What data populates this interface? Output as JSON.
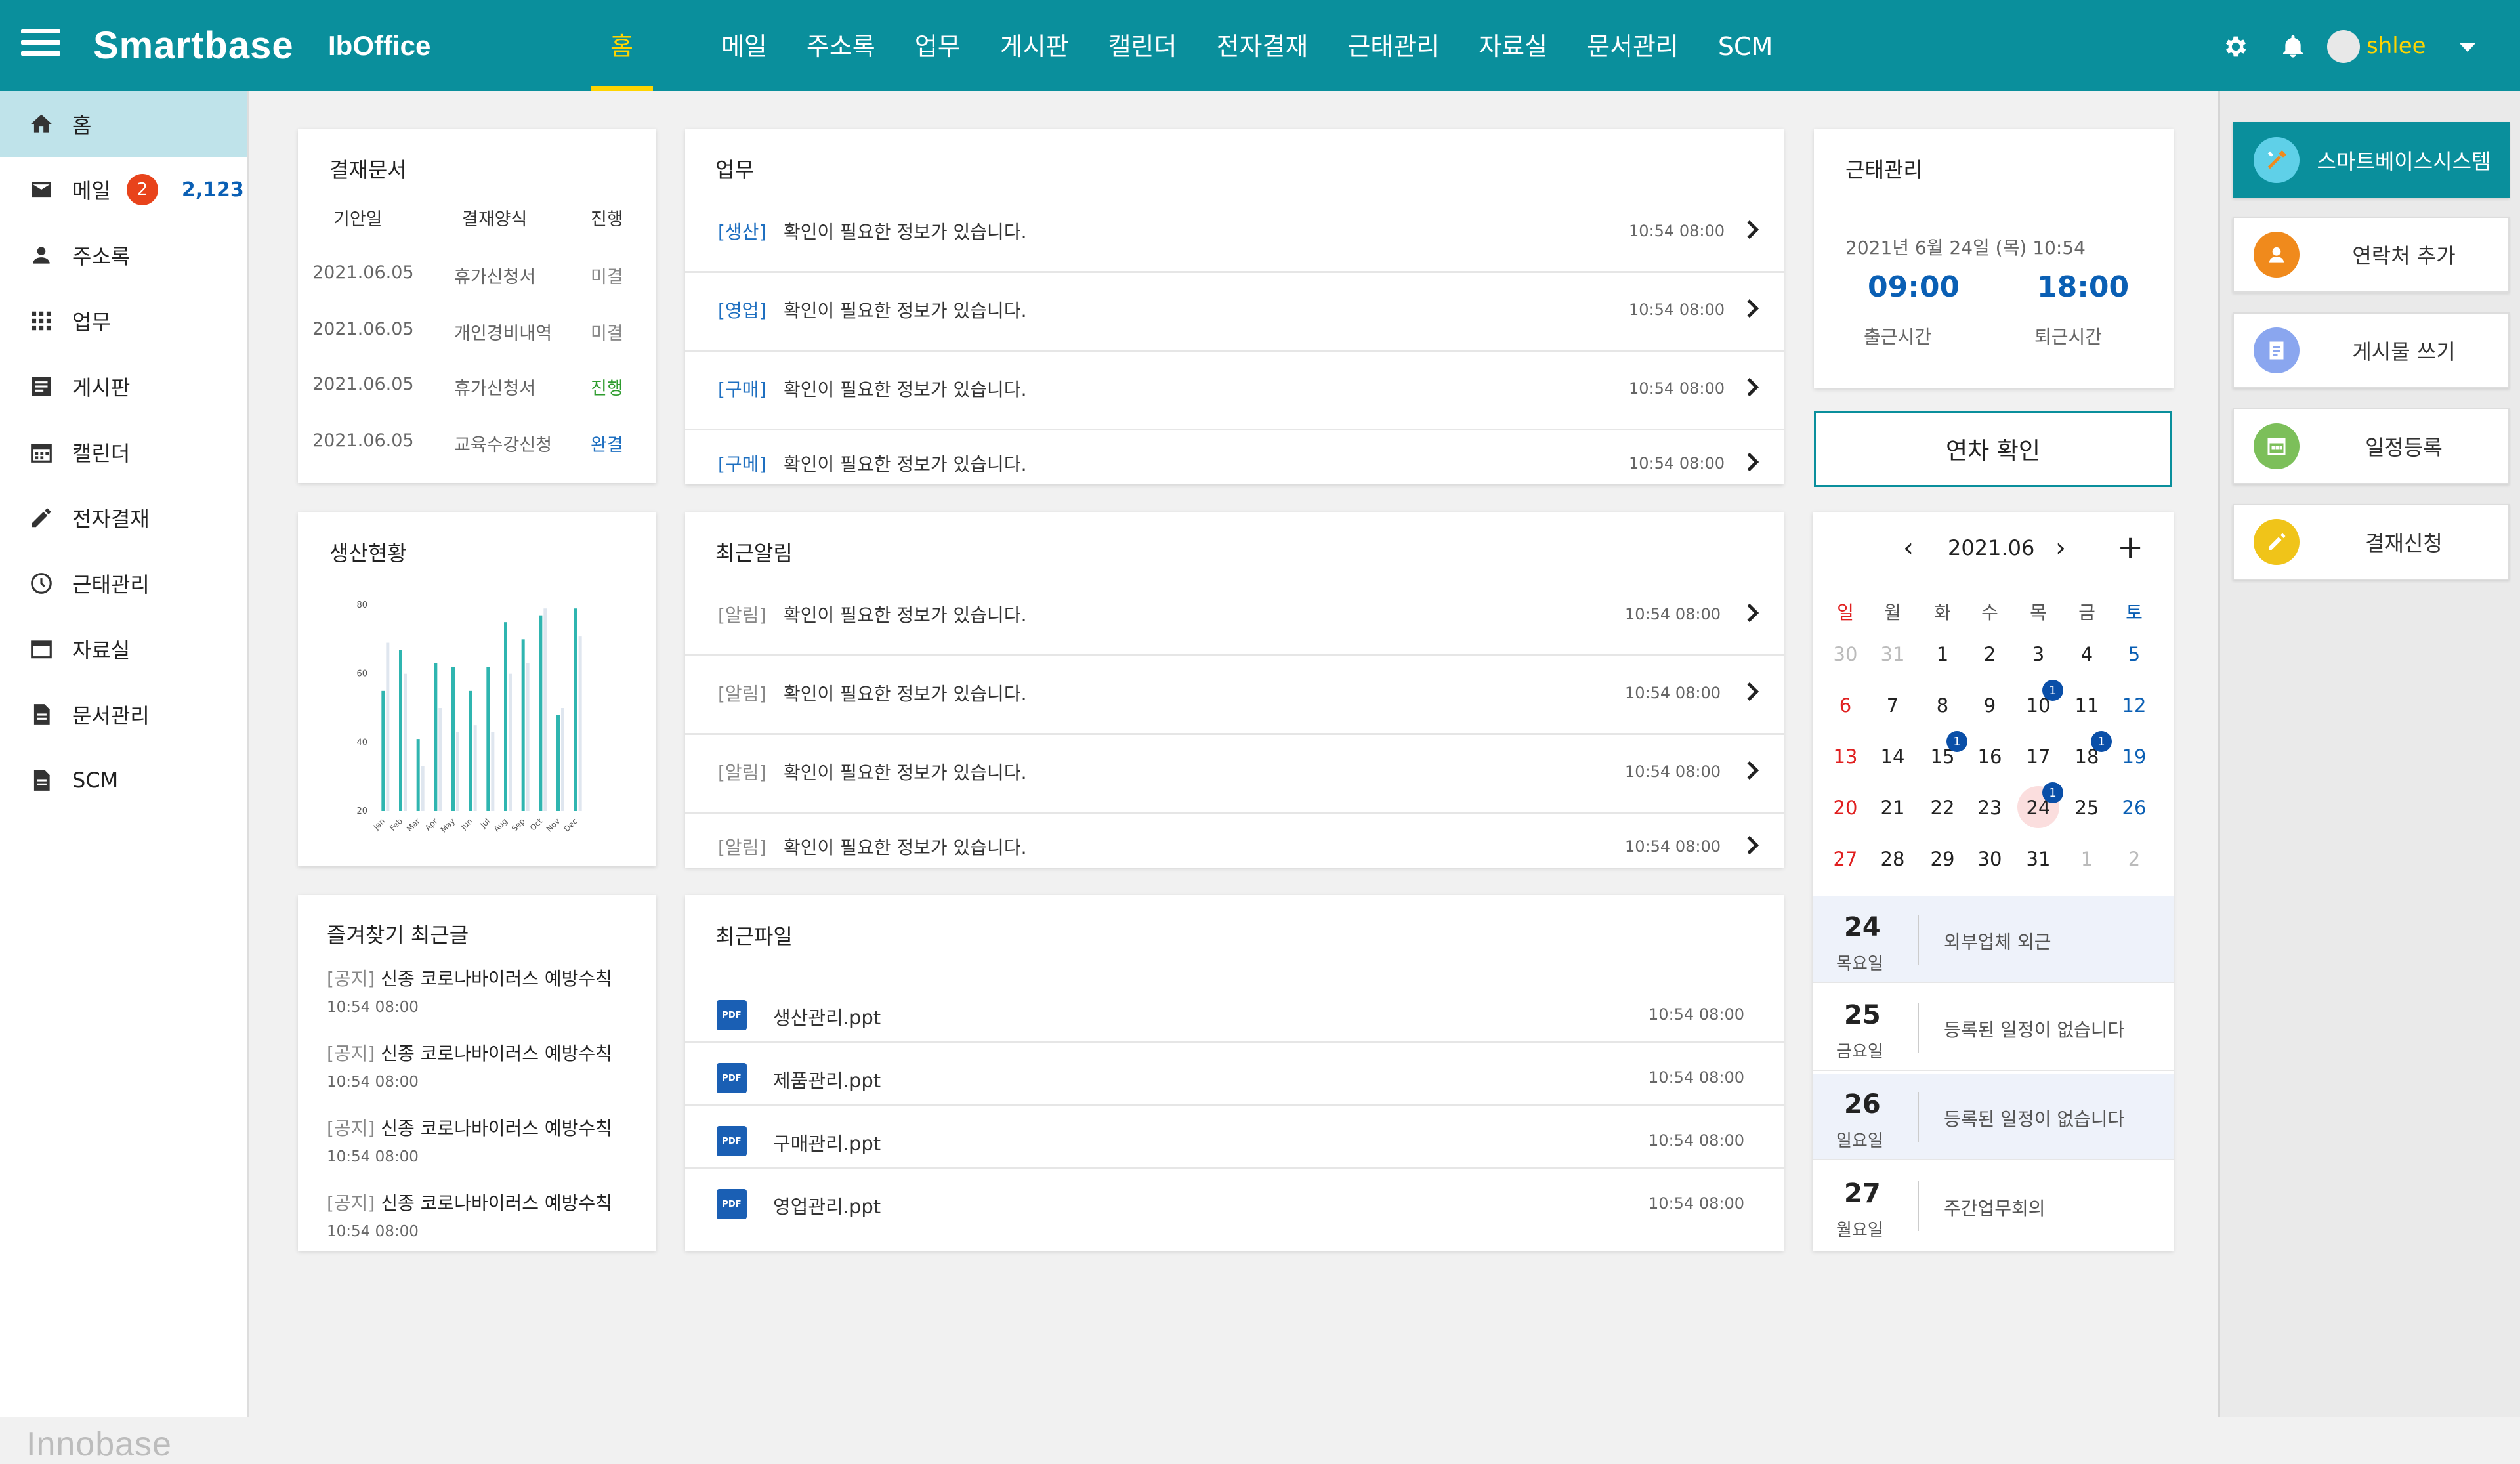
{
  "brand": {
    "name": "Smartbase",
    "product": "IbOffice",
    "footer": "Innobase"
  },
  "nav": [
    "홈",
    "메일",
    "주소록",
    "업무",
    "게시판",
    "캘린더",
    "전자결재",
    "근태관리",
    "자료실",
    "문서관리",
    "SCM"
  ],
  "user": {
    "name": "shlee"
  },
  "sidebar": {
    "items": [
      {
        "label": "홈",
        "icon": "home-icon"
      },
      {
        "label": "메일",
        "icon": "mail-icon",
        "badge": "2",
        "count": "2,123"
      },
      {
        "label": "주소록",
        "icon": "person-icon"
      },
      {
        "label": "업무",
        "icon": "grid-icon"
      },
      {
        "label": "게시판",
        "icon": "board-icon"
      },
      {
        "label": "캘린더",
        "icon": "calendar-icon"
      },
      {
        "label": "전자결재",
        "icon": "pen-icon"
      },
      {
        "label": "근태관리",
        "icon": "clock-icon"
      },
      {
        "label": "자료실",
        "icon": "folder-icon"
      },
      {
        "label": "문서관리",
        "icon": "document-icon"
      },
      {
        "label": "SCM",
        "icon": "scm-icon"
      }
    ]
  },
  "approval": {
    "title": "결재문서",
    "headers": [
      "기안일",
      "결재양식",
      "진행"
    ],
    "rows": [
      {
        "date": "2021.06.05",
        "form": "휴가신청서",
        "status": "미결",
        "status_color": "#888888"
      },
      {
        "date": "2021.06.05",
        "form": "개인경비내역",
        "status": "미결",
        "status_color": "#888888"
      },
      {
        "date": "2021.06.05",
        "form": "휴가신청서",
        "status": "진행",
        "status_color": "#2e9c2e"
      },
      {
        "date": "2021.06.05",
        "form": "교육수강신청",
        "status": "완결",
        "status_color": "#1e6fc0"
      }
    ]
  },
  "tasks": {
    "title": "업무",
    "rows": [
      {
        "tag": "[생산]",
        "text": "확인이 필요한 정보가 있습니다.",
        "time": "10:54 08:00"
      },
      {
        "tag": "[영업]",
        "text": "확인이 필요한 정보가 있습니다.",
        "time": "10:54 08:00"
      },
      {
        "tag": "[구매]",
        "text": "확인이 필요한 정보가 있습니다.",
        "time": "10:54 08:00"
      },
      {
        "tag": "[구메]",
        "text": "확인이 필요한 정보가 있습니다.",
        "time": "10:54 08:00"
      }
    ]
  },
  "attendance": {
    "title": "근태관리",
    "datetime": "2021년 6월 24일 (목) 10:54",
    "in_time": "09:00",
    "in_label": "출근시간",
    "out_time": "18:00",
    "out_label": "퇴근시간",
    "leave_button": "연차 확인"
  },
  "production": {
    "title": "생산현황",
    "chart_data": {
      "type": "bar",
      "categories": [
        "Jan",
        "Feb",
        "Mar",
        "Apr",
        "May",
        "Jun",
        "Jul",
        "Aug",
        "Sep",
        "Oct",
        "Nov",
        "Dec"
      ],
      "series": [
        {
          "values": [
            55,
            67,
            41,
            63,
            62,
            55,
            62,
            75,
            70,
            77,
            48,
            79
          ],
          "color": "#2fb5b0"
        },
        {
          "values": [
            69,
            60,
            33,
            50,
            43,
            45,
            43,
            60,
            63,
            79,
            50,
            71
          ],
          "color": "#dfe6ef"
        }
      ],
      "yticks": [
        20,
        40,
        60,
        80
      ],
      "ylim": [
        20,
        80
      ]
    }
  },
  "alerts": {
    "title": "최근알림",
    "rows": [
      {
        "tag": "[알림]",
        "text": "확인이 필요한 정보가 있습니다.",
        "time": "10:54 08:00"
      },
      {
        "tag": "[알림]",
        "text": "확인이 필요한 정보가 있습니다.",
        "time": "10:54 08:00"
      },
      {
        "tag": "[알림]",
        "text": "확인이 필요한 정보가 있습니다.",
        "time": "10:54 08:00"
      },
      {
        "tag": "[알림]",
        "text": "확인이 필요한 정보가 있습니다.",
        "time": "10:54 08:00"
      }
    ]
  },
  "calendar": {
    "month": "2021.06",
    "weekdays": [
      "일",
      "월",
      "화",
      "수",
      "목",
      "금",
      "토"
    ],
    "weeks": [
      [
        "30",
        "31",
        "1",
        "2",
        "3",
        "4",
        "5"
      ],
      [
        "6",
        "7",
        "8",
        "9",
        "10",
        "11",
        "12"
      ],
      [
        "13",
        "14",
        "15",
        "16",
        "17",
        "18",
        "19"
      ],
      [
        "20",
        "21",
        "22",
        "23",
        "24",
        "25",
        "26"
      ],
      [
        "27",
        "28",
        "29",
        "30",
        "31",
        "1",
        "2"
      ]
    ],
    "event_marks": [
      {
        "day": "10",
        "count": "1"
      },
      {
        "day": "15",
        "count": "1"
      },
      {
        "day": "18",
        "count": "1"
      },
      {
        "day": "24",
        "count": "1"
      }
    ],
    "today": "24"
  },
  "schedule": [
    {
      "day": "24",
      "weekday": "목요일",
      "event": "외부업체 외근"
    },
    {
      "day": "25",
      "weekday": "금요일",
      "event": "등록된 일정이 없습니다"
    },
    {
      "day": "26",
      "weekday": "일요일",
      "event": "등록된 일정이 없습니다"
    },
    {
      "day": "27",
      "weekday": "월요일",
      "event": "주간업무회의"
    }
  ],
  "favorites": {
    "title": "즐겨찾기 최근글",
    "rows": [
      {
        "tag": "[공지]",
        "text": "신종 코로나바이러스 예방수칙",
        "time": "10:54 08:00"
      },
      {
        "tag": "[공지]",
        "text": "신종 코로나바이러스 예방수칙",
        "time": "10:54 08:00"
      },
      {
        "tag": "[공지]",
        "text": "신종 코로나바이러스 예방수칙",
        "time": "10:54 08:00"
      },
      {
        "tag": "[공지]",
        "text": "신종 코로나바이러스 예방수칙",
        "time": "10:54 08:00"
      }
    ]
  },
  "files": {
    "title": "최근파일",
    "rows": [
      {
        "icon": "PDF",
        "name": "생산관리.ppt",
        "time": "10:54 08:00"
      },
      {
        "icon": "PDF",
        "name": "제품관리.ppt",
        "time": "10:54 08:00"
      },
      {
        "icon": "PDF",
        "name": "구매관리.ppt",
        "time": "10:54 08:00"
      },
      {
        "icon": "PDF",
        "name": "영업관리.ppt",
        "time": "10:54 08:00"
      }
    ]
  },
  "quick_actions": [
    {
      "label": "스마트베이스시스템",
      "icon": "tools-icon",
      "color": "#5fd0e8"
    },
    {
      "label": "연락처 추가",
      "icon": "person-icon",
      "color": "#f08a1c"
    },
    {
      "label": "게시물 쓰기",
      "icon": "document-icon",
      "color": "#8aa6ef"
    },
    {
      "label": "일정등록",
      "icon": "calendar-icon",
      "color": "#7cbf5a"
    },
    {
      "label": "결재신청",
      "icon": "pen-icon",
      "color": "#f0c419"
    }
  ]
}
